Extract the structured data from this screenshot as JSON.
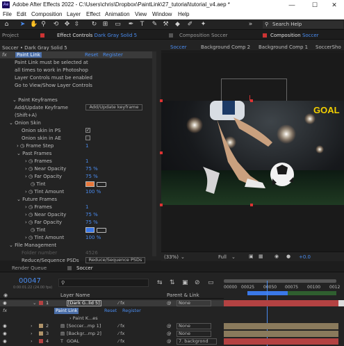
{
  "title_bar": {
    "app_icon": "Ae",
    "title": "Adobe After Effects 2022 - C:\\Users\\chris\\Dropbox\\PaintLink\\27_tutorial\\tutorial_v4.aep *",
    "minimize": "—",
    "maximize": "☐",
    "close": "✕"
  },
  "menu": [
    "File",
    "Edit",
    "Composition",
    "Layer",
    "Effect",
    "Animation",
    "View",
    "Window",
    "Help"
  ],
  "toolbar": {
    "search_help": "Search Help"
  },
  "left_panel": {
    "tab_project": "Project",
    "tab_effect_controls": "Effect Controls",
    "tab_effect_controls_layer": "Dark Gray Solid 5",
    "layer_path": "Soccer • Dark Gray Solid 5",
    "fx_label": "fx",
    "effect_name": "Paint Link",
    "reset": "Reset",
    "register": "Register",
    "notes": [
      "Paint Link must be selected at",
      "all times to work in Photoshop",
      "Layer Controls must be enabled",
      "Go to View/Show Layer Controls"
    ],
    "paint_keyframes": "Paint Keyframes",
    "add_update_keyframe": "Add/Update Keyframe",
    "shift_a": "(Shift+A)",
    "add_update_keyframe_btn": "Add/Update keyframe",
    "onion_skin": "Onion Skin",
    "onion_skin_ps": "Onion skin in PS",
    "onion_skin_ae": "Onion skin in AE",
    "frame_step": "Frame Step",
    "frame_step_value": "1",
    "past_frames": "Past Frames",
    "frames": "Frames",
    "near_opacity": "Near Opacity",
    "far_opacity": "Far Opacity",
    "tint": "Tint",
    "tint_amount": "Tint Amount",
    "past_frames_value": "1",
    "past_near_opacity": "75 %",
    "past_far_opacity": "75 %",
    "past_tint_amount": "100 %",
    "past_tint_color": "#e8773a",
    "future_frames": "Future Frames",
    "future_frames_value": "1",
    "future_near_opacity": "75 %",
    "future_far_opacity": "75 %",
    "future_tint_amount": "100 %",
    "future_tint_color": "#3a78e8",
    "file_management": "File Management",
    "folder_number": "Folder number",
    "folder_number_value": "4526",
    "reduce_label": "Reduce/Sequence PSDs",
    "reduce_btn": "Reduce/Sequence PSDs"
  },
  "comp_panel": {
    "tab_comp_soccer_1": "Composition Soccer",
    "tab_comp_soccer_2": "Composition",
    "tab_comp_soccer_2_name": "Soccer",
    "subtabs": [
      "Soccer",
      "Background Comp 2",
      "Background Comp 1",
      "SoccerSho"
    ],
    "goal_text": "GOAL",
    "zoom": "(33%)",
    "resolution": "Full",
    "exposure": "+0.0"
  },
  "timeline": {
    "tab_render_queue": "Render Queue",
    "tab_soccer": "Soccer",
    "current_time": "00047",
    "timecode_sub": "0:00:01:22 (24.00 fps)",
    "search_placeholder": "",
    "col_layer_name": "Layer Name",
    "col_parent_link": "Parent & Link",
    "ruler_ticks": [
      "00000",
      "00025",
      "00050",
      "00075",
      "00100",
      "0012"
    ],
    "layers": [
      {
        "num": "1",
        "name": "[Dark G..lid 5]",
        "parent": "None",
        "label_color": "#b34242"
      },
      {
        "num": "2",
        "name": "[Soccer...mp 1]",
        "parent": "None",
        "label_color": "#b0946a"
      },
      {
        "num": "3",
        "name": "[Backgr...mp 2]",
        "parent": "None",
        "label_color": "#b0946a"
      },
      {
        "num": "4",
        "name": "GOAL",
        "parent": "7. backgrond",
        "label_color": "#b34242"
      }
    ],
    "effect_paint_link": "Paint Link",
    "effect_reset": "Reset",
    "effect_register": "Register",
    "paint_k_exp": "Paint K...es"
  }
}
